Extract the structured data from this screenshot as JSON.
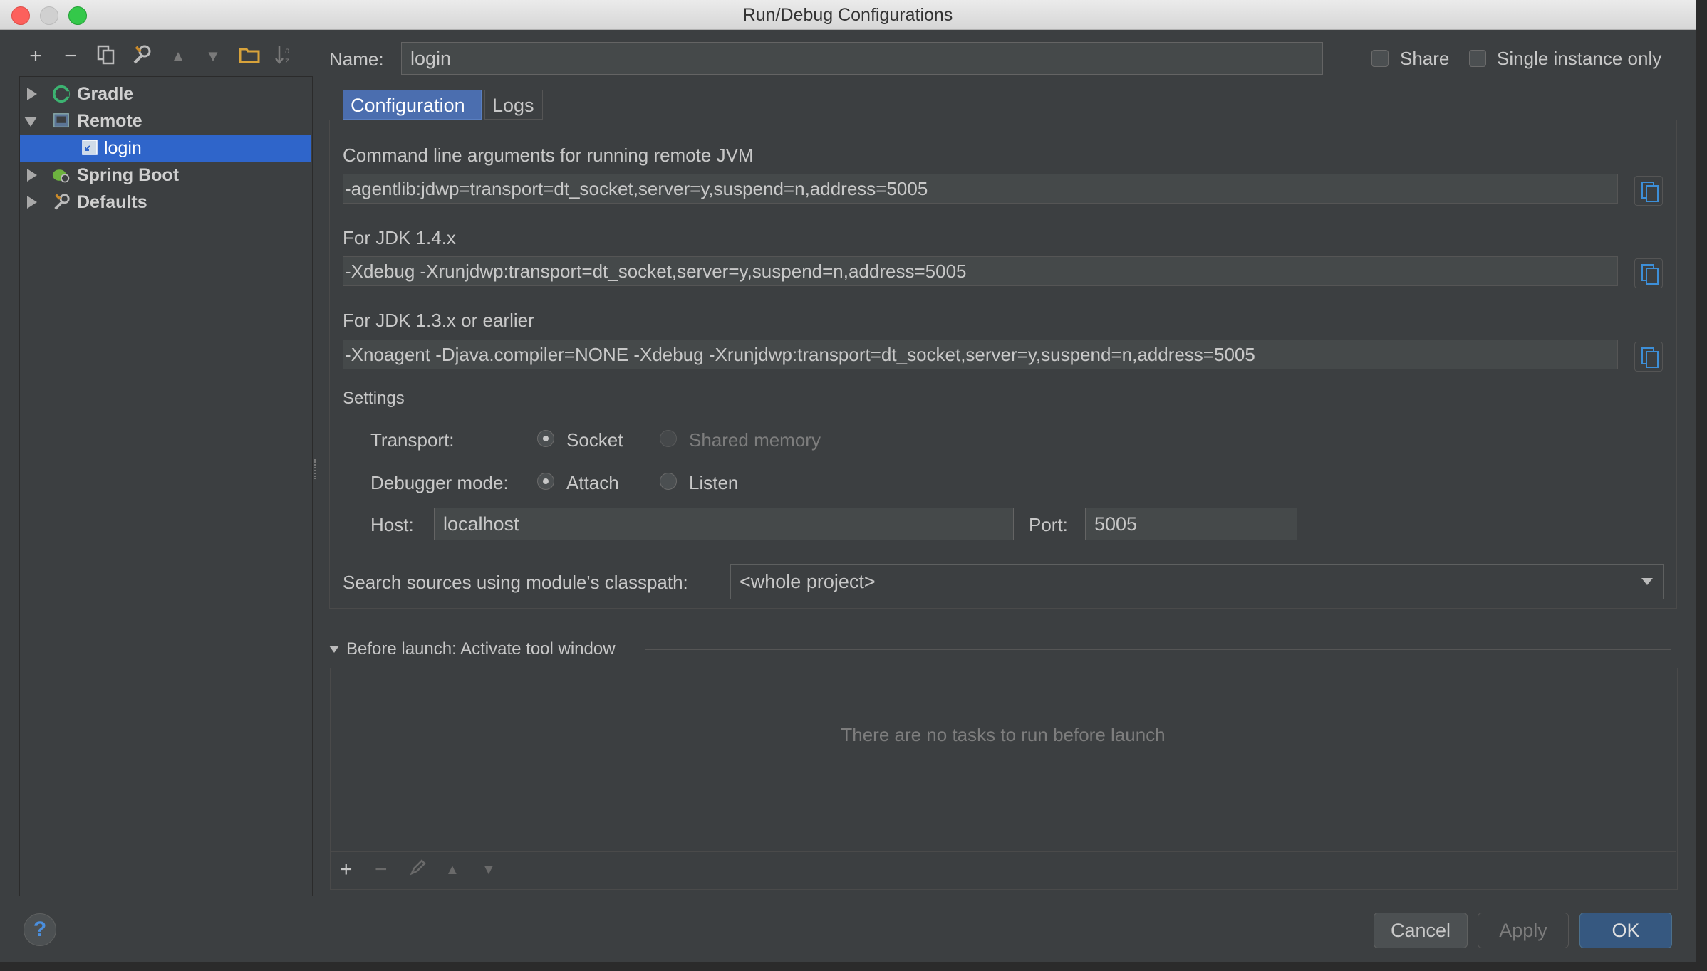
{
  "window": {
    "title": "Run/Debug Configurations"
  },
  "toolbar": {
    "add": "+",
    "remove": "−",
    "up": "▲",
    "down": "▼"
  },
  "tree": [
    {
      "label": "Gradle"
    },
    {
      "label": "Remote"
    },
    {
      "label": "login"
    },
    {
      "label": "Spring Boot"
    },
    {
      "label": "Defaults"
    }
  ],
  "name": {
    "label": "Name:",
    "value": "login"
  },
  "share": {
    "label": "Share"
  },
  "single_instance": {
    "label": "Single instance only"
  },
  "tabs": [
    {
      "label": "Configuration"
    },
    {
      "label": "Logs"
    }
  ],
  "config": {
    "cmd_label": "Command line arguments for running remote JVM",
    "cmd_value": "-agentlib:jdwp=transport=dt_socket,server=y,suspend=n,address=5005",
    "jdk14_label": "For JDK 1.4.x",
    "jdk14_value": "-Xdebug -Xrunjdwp:transport=dt_socket,server=y,suspend=n,address=5005",
    "jdk13_label": "For JDK 1.3.x or earlier",
    "jdk13_value": "-Xnoagent -Djava.compiler=NONE -Xdebug -Xrunjdwp:transport=dt_socket,server=y,suspend=n,address=5005"
  },
  "settings": {
    "title": "Settings",
    "transport_label": "Transport:",
    "transport_socket": "Socket",
    "transport_shared": "Shared memory",
    "debugger_label": "Debugger mode:",
    "debugger_attach": "Attach",
    "debugger_listen": "Listen",
    "host_label": "Host:",
    "host_value": "localhost",
    "port_label": "Port:",
    "port_value": "5005"
  },
  "classpath": {
    "label": "Search sources using module's classpath:",
    "value": "<whole project>"
  },
  "before_launch": {
    "title": "Before launch: Activate tool window",
    "empty": "There are no tasks to run before launch"
  },
  "buttons": {
    "cancel": "Cancel",
    "apply": "Apply",
    "ok": "OK",
    "help": "?"
  }
}
